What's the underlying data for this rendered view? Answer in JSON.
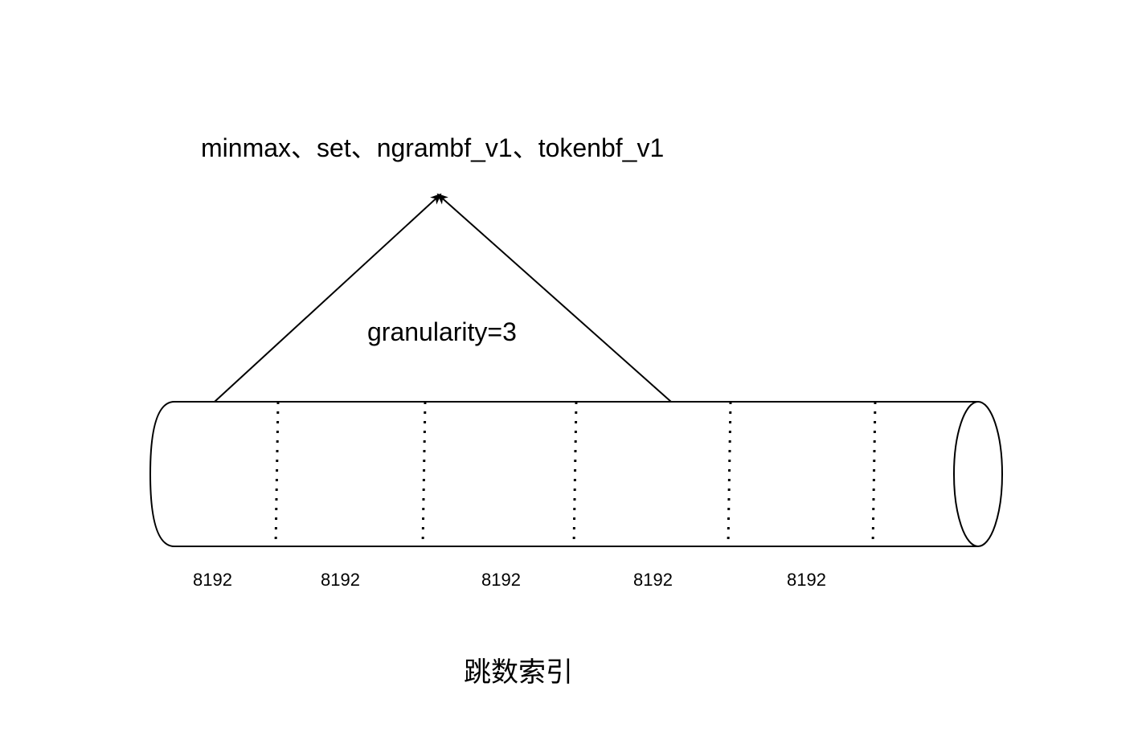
{
  "diagram": {
    "index_types_label": "minmax、set、ngrambf_v1、tokenbf_v1",
    "granularity_label": "granularity=3",
    "granule_sizes": [
      "8192",
      "8192",
      "8192",
      "8192",
      "8192"
    ],
    "caption": "跳数索引"
  },
  "colors": {
    "stroke": "#000000",
    "background": "#ffffff"
  }
}
